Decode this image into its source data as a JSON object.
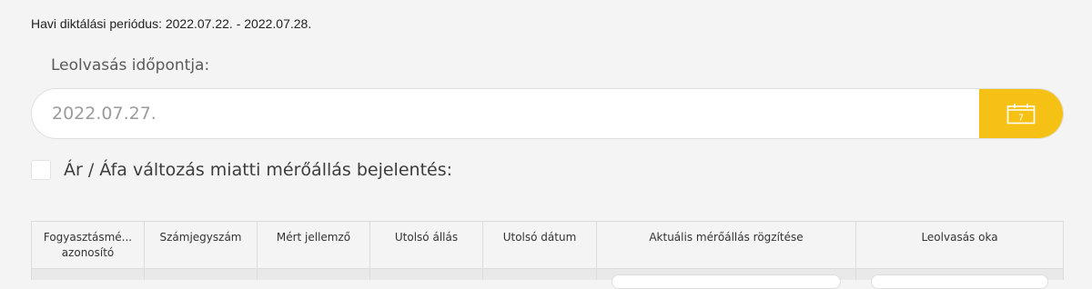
{
  "period": {
    "text": "Havi diktálási periódus: 2022.07.22. - 2022.07.28."
  },
  "reading": {
    "label": "Leolvasás időpontja:",
    "date_value": "2022.07.27.",
    "calendar_icon": "calendar-icon",
    "calendar_day": "7",
    "accent_color": "#f5c115"
  },
  "price_change": {
    "label": "Ár / Áfa változás miatti mérőállás bejelentés:",
    "checked": false
  },
  "table": {
    "columns": [
      {
        "label": "Fogyasztásmé... azonosító"
      },
      {
        "label": "Számjegyszám"
      },
      {
        "label": "Mért jellemző"
      },
      {
        "label": "Utolsó állás"
      },
      {
        "label": "Utolsó dátum"
      },
      {
        "label": "Aktuális mérőállás rögzítése"
      },
      {
        "label": "Leolvasás oka"
      }
    ]
  }
}
